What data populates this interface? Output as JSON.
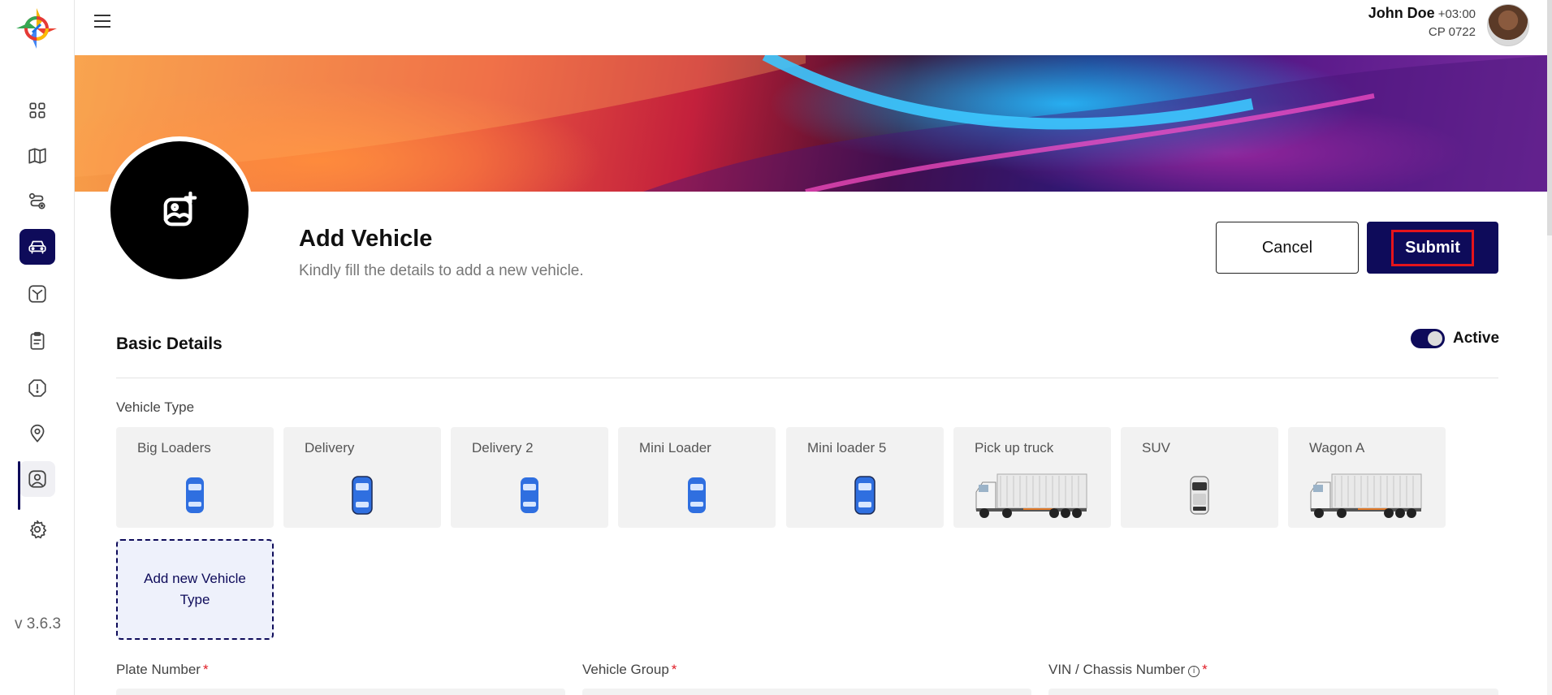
{
  "app": {
    "version": "v 3.6.3"
  },
  "user": {
    "name": "John Doe",
    "timezone": "+03:00",
    "code": "CP 0722"
  },
  "sidebar": {
    "items": [
      {
        "name": "dashboard",
        "icon": "grid-icon"
      },
      {
        "name": "map",
        "icon": "map-icon"
      },
      {
        "name": "routes",
        "icon": "route-icon"
      },
      {
        "name": "vehicles",
        "icon": "car-icon",
        "active": true
      },
      {
        "name": "tires",
        "icon": "axle-icon"
      },
      {
        "name": "tasks",
        "icon": "clipboard-icon"
      },
      {
        "name": "alerts",
        "icon": "alert-shield-icon"
      },
      {
        "name": "locations",
        "icon": "location-pin-icon"
      },
      {
        "name": "profile",
        "icon": "user-square-icon"
      },
      {
        "name": "settings",
        "icon": "gear-icon"
      }
    ]
  },
  "page": {
    "title": "Add Vehicle",
    "subtitle": "Kindly fill the details to add a new vehicle.",
    "cancel_label": "Cancel",
    "submit_label": "Submit"
  },
  "basic_details": {
    "title": "Basic Details",
    "active_label": "Active",
    "active": true,
    "vehicle_type_label": "Vehicle Type",
    "vehicle_types": [
      {
        "name": "Big Loaders",
        "icon": "car-blue"
      },
      {
        "name": "Delivery",
        "icon": "car-blue-large"
      },
      {
        "name": "Delivery 2",
        "icon": "car-blue"
      },
      {
        "name": "Mini Loader",
        "icon": "car-blue"
      },
      {
        "name": "Mini loader 5",
        "icon": "car-blue-large"
      },
      {
        "name": "Pick up truck",
        "icon": "truck"
      },
      {
        "name": "SUV",
        "icon": "car-white"
      },
      {
        "name": "Wagon A",
        "icon": "truck"
      }
    ],
    "add_type_label": "Add new Vehicle Type",
    "fields": [
      {
        "label": "Plate Number",
        "required": "*"
      },
      {
        "label": "Vehicle Group",
        "required": "*"
      },
      {
        "label": "VIN / Chassis Number",
        "required": "*",
        "info_icon": "i"
      }
    ]
  },
  "colors": {
    "primary": "#0e0b5a",
    "required": "#e01b24",
    "card_bg": "#f2f2f2",
    "car_blue": "#2f6fe0"
  }
}
